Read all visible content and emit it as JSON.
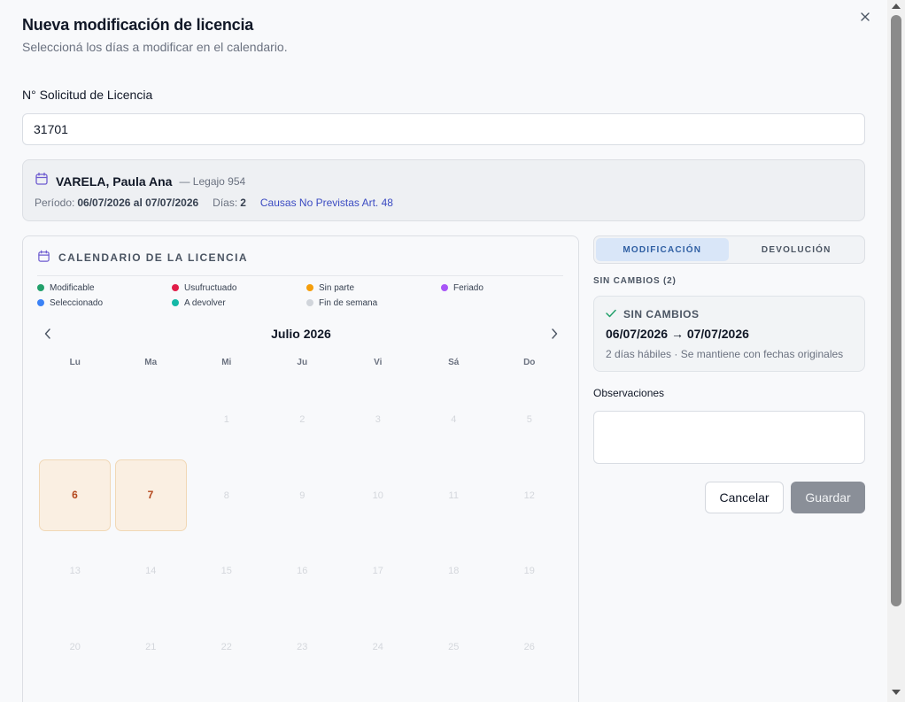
{
  "dialog": {
    "title": "Nueva modificación de licencia",
    "subtitle": "Seleccioná los días a modificar en el calendario.",
    "close_icon": "close-icon"
  },
  "request": {
    "label": "N° Solicitud de Licencia",
    "value": "31701"
  },
  "employee": {
    "icon": "calendar-icon",
    "name": "VARELA, Paula Ana",
    "legajo": "— Legajo 954",
    "period_label": "Período:",
    "period_value": "06/07/2026 al 07/07/2026",
    "days_label": "Días:",
    "days_value": "2",
    "cause": "Causas No Previstas Art. 48"
  },
  "calendar": {
    "heading": "CALENDARIO DE LA LICENCIA",
    "legend": [
      {
        "label": "Modificable",
        "color": "#22a06b"
      },
      {
        "label": "Usufructuado",
        "color": "#e11d48"
      },
      {
        "label": "Sin parte",
        "color": "#f59e0b"
      },
      {
        "label": "Feriado",
        "color": "#a855f7"
      },
      {
        "label": "Seleccionado",
        "color": "#3b82f6"
      },
      {
        "label": "A devolver",
        "color": "#14b8a6"
      },
      {
        "label": "Fin de semana",
        "color": "#d1d5db"
      }
    ],
    "month": "Julio 2026",
    "weekdays": [
      "Lu",
      "Ma",
      "Mi",
      "Ju",
      "Vi",
      "Sá",
      "Do"
    ],
    "leading_blanks": 2,
    "days": [
      "1",
      "2",
      "3",
      "4",
      "5",
      "6",
      "7",
      "8",
      "9",
      "10",
      "11",
      "12",
      "13",
      "14",
      "15",
      "16",
      "17",
      "18",
      "19",
      "20",
      "21",
      "22",
      "23",
      "24",
      "25",
      "26"
    ],
    "active_days": [
      "6",
      "7"
    ],
    "active_color": "#faefe2"
  },
  "tabs": [
    {
      "label": "MODIFICACIÓN",
      "active": true
    },
    {
      "label": "DEVOLUCIÓN",
      "active": false
    }
  ],
  "summary": {
    "section_label": "SIN CAMBIOS (2)",
    "status_icon": "check-icon",
    "status_title": "SIN CAMBIOS",
    "range": "06/07/2026 → 07/07/2026",
    "note": "2 días hábiles · Se mantiene con fechas originales"
  },
  "observations": {
    "label": "Observaciones",
    "value": ""
  },
  "actions": {
    "cancel": "Cancelar",
    "save": "Guardar"
  }
}
